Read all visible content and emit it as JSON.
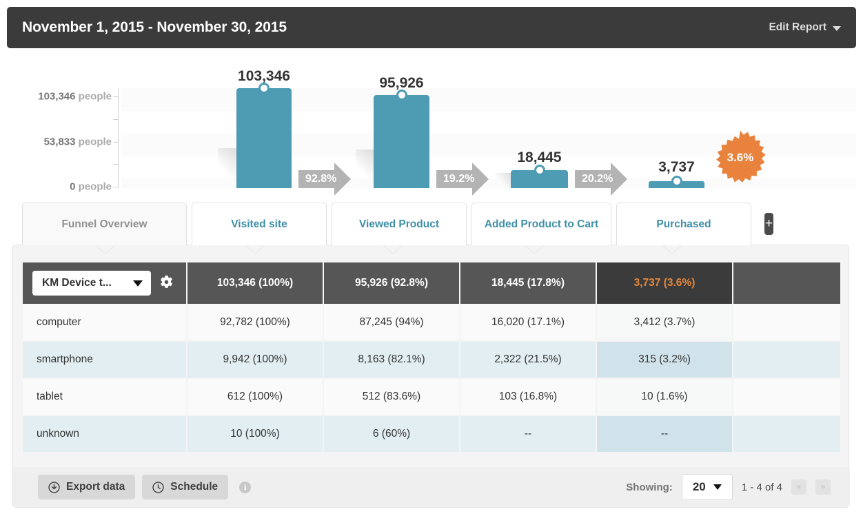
{
  "header": {
    "title": "November 1, 2015 - November 30, 2015",
    "edit_report_label": "Edit Report"
  },
  "chart_data": {
    "type": "bar",
    "title": "",
    "xlabel": "",
    "ylabel": "people",
    "ylim": [
      0,
      103346
    ],
    "grid": true,
    "categories": [
      "Visited site",
      "Viewed Product",
      "Added Product to Cart",
      "Purchased"
    ],
    "values": [
      103346,
      95926,
      18445,
      3737
    ],
    "value_labels": [
      "103,346",
      "95,926",
      "18,445",
      "3,737"
    ],
    "ytick_labels": [
      "103,346 people",
      "53,833 people",
      "0 people"
    ],
    "ytick_numbers": [
      "103,346",
      "53,833",
      "0"
    ],
    "ytick_unit": "people",
    "ytick_values": [
      103346,
      53833,
      0
    ],
    "step_conversions": [
      "92.8%",
      "19.2%",
      "20.2%"
    ],
    "overall_conversion": "3.6%",
    "bar_color": "#4e9cb3",
    "arrow_color": "#b3b3b3",
    "burst_color": "#e8823c"
  },
  "tabs": [
    {
      "label": "Funnel Overview",
      "active": false,
      "muted": true
    },
    {
      "label": "Visited site",
      "active": true,
      "muted": false
    },
    {
      "label": "Viewed Product",
      "active": true,
      "muted": false
    },
    {
      "label": "Added Product to Cart",
      "active": true,
      "muted": false
    },
    {
      "label": "Purchased",
      "active": true,
      "muted": false
    }
  ],
  "tab_add_label": "+",
  "table": {
    "dimension_select": "KM Device t...",
    "headers": [
      "103,346 (100%)",
      "95,926 (92.8%)",
      "18,445 (17.8%)",
      "3,737 (3.6%)",
      ""
    ],
    "rows": [
      {
        "label": "computer",
        "cells": [
          "92,782 (100%)",
          "87,245 (94%)",
          "16,020 (17.1%)",
          "3,412 (3.7%)",
          ""
        ]
      },
      {
        "label": "smartphone",
        "cells": [
          "9,942 (100%)",
          "8,163 (82.1%)",
          "2,322 (21.5%)",
          "315 (3.2%)",
          ""
        ]
      },
      {
        "label": "tablet",
        "cells": [
          "612 (100%)",
          "512 (83.6%)",
          "103 (16.8%)",
          "10 (1.6%)",
          ""
        ]
      },
      {
        "label": "unknown",
        "cells": [
          "10 (100%)",
          "6 (60%)",
          "--",
          "--",
          ""
        ]
      }
    ]
  },
  "footer": {
    "export_label": "Export data",
    "schedule_label": "Schedule",
    "info_label": "i",
    "showing_label": "Showing:",
    "page_size": "20",
    "range_label": "1 - 4 of 4",
    "prev_label": "«",
    "next_label": "»"
  }
}
